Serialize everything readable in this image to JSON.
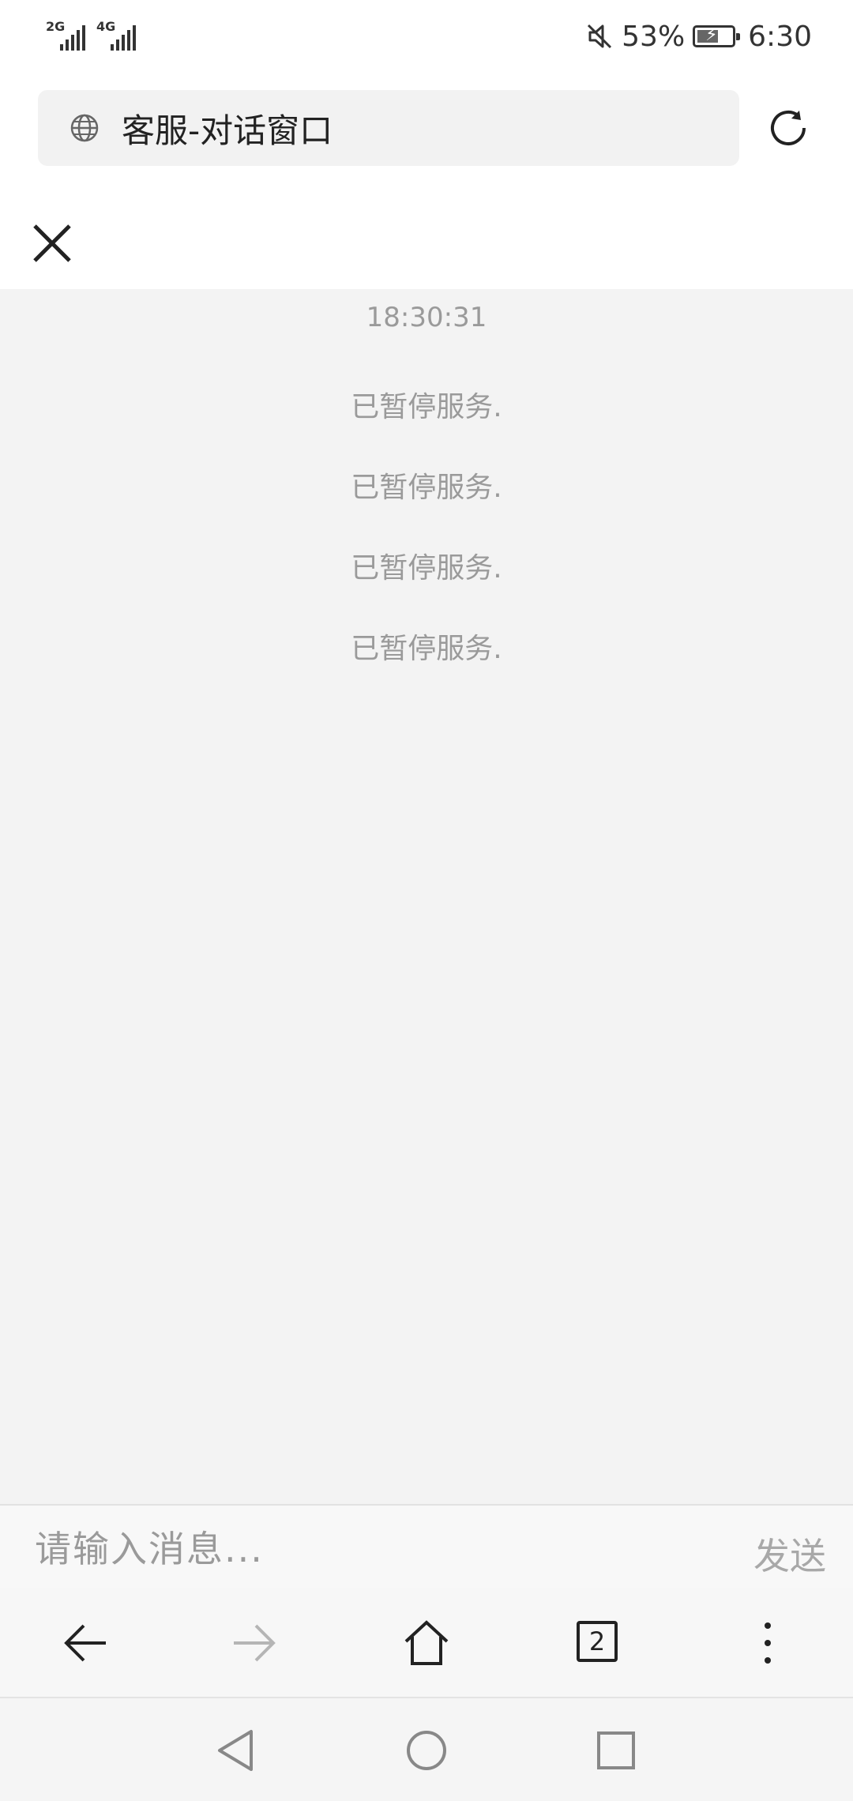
{
  "status_bar": {
    "sim1_network": "2G",
    "sim2_network": "4G",
    "battery_percent": "53%",
    "time": "6:30",
    "icons": [
      "signal-icon",
      "mute-icon",
      "battery-charging-icon"
    ]
  },
  "address_bar": {
    "title": "客服-对话窗口",
    "icons": [
      "globe-icon",
      "reload-icon"
    ]
  },
  "chat": {
    "timestamp": "18:30:31",
    "messages": [
      "已暂停服务.",
      "已暂停服务.",
      "已暂停服务.",
      "已暂停服务."
    ]
  },
  "composer": {
    "placeholder": "请输入消息...",
    "value": "",
    "send_label": "发送"
  },
  "browser_nav": {
    "tabs_count": "2",
    "icons": [
      "back-icon",
      "forward-icon",
      "home-icon",
      "tabs-icon",
      "more-icon"
    ]
  },
  "system_nav": {
    "icons": [
      "system-back-icon",
      "system-home-icon",
      "system-recents-icon"
    ]
  }
}
